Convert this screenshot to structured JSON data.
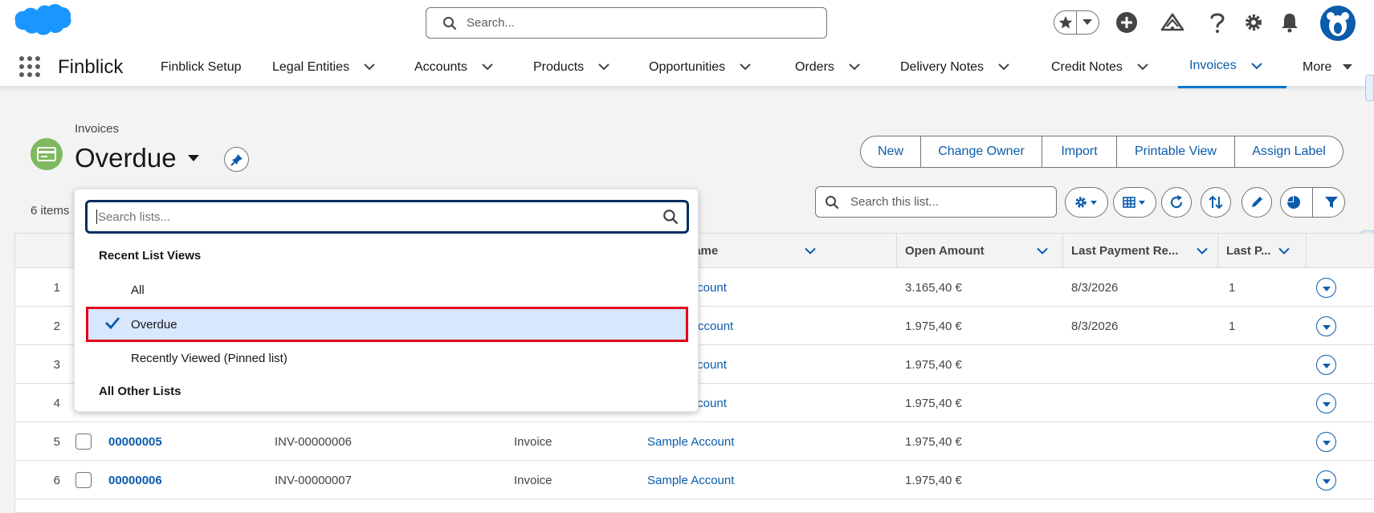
{
  "header": {
    "search_placeholder": "Search...",
    "icons": [
      "favorites-star-icon",
      "favorites-list-icon",
      "global-actions-icon",
      "trailhead-icon",
      "help-icon",
      "setup-gear-icon",
      "notifications-bell-icon",
      "user-avatar"
    ]
  },
  "nav": {
    "app_name": "Finblick",
    "items": [
      {
        "label": "Finblick Setup",
        "has_menu": false
      },
      {
        "label": "Legal Entities",
        "has_menu": true
      },
      {
        "label": "Accounts",
        "has_menu": true
      },
      {
        "label": "Products",
        "has_menu": true
      },
      {
        "label": "Opportunities",
        "has_menu": true
      },
      {
        "label": "Orders",
        "has_menu": true
      },
      {
        "label": "Delivery Notes",
        "has_menu": true
      },
      {
        "label": "Credit Notes",
        "has_menu": true
      },
      {
        "label": "Invoices",
        "has_menu": true,
        "active": true
      },
      {
        "label": "More",
        "has_menu": true
      }
    ]
  },
  "page": {
    "breadcrumb": "Invoices",
    "title": "Overdue",
    "items_count": "6 items",
    "actions": [
      "New",
      "Change Owner",
      "Import",
      "Printable View",
      "Assign Label"
    ],
    "list_search_placeholder": "Search this list..."
  },
  "table": {
    "columns": [
      {
        "label": "",
        "key": "num"
      },
      {
        "label": "",
        "key": "select"
      },
      {
        "label": "",
        "key": "number"
      },
      {
        "label": "",
        "key": "invoice_no"
      },
      {
        "label": "",
        "key": "type"
      },
      {
        "label": "nt Name",
        "key": "account"
      },
      {
        "label": "Open Amount",
        "key": "open_amount"
      },
      {
        "label": "Last Payment Re...",
        "key": "last_payment"
      },
      {
        "label": "Last P...",
        "key": "last_p"
      }
    ],
    "rows": [
      {
        "num": "1",
        "number": "",
        "invoice_no": "",
        "type": "",
        "account": "e Account",
        "open_amount": "3.165,40 €",
        "last_payment": "8/3/2026",
        "last_p": "1"
      },
      {
        "num": "2",
        "number": "",
        "invoice_no": "",
        "type": "",
        "account": "Account",
        "open_amount": "1.975,40 €",
        "last_payment": "8/3/2026",
        "last_p": "1"
      },
      {
        "num": "3",
        "number": "",
        "invoice_no": "",
        "type": "",
        "account": "e Account",
        "open_amount": "1.975,40 €",
        "last_payment": "",
        "last_p": ""
      },
      {
        "num": "4",
        "number": "",
        "invoice_no": "",
        "type": "",
        "account": "e Account",
        "open_amount": "1.975,40 €",
        "last_payment": "",
        "last_p": ""
      },
      {
        "num": "5",
        "number": "00000005",
        "invoice_no": "INV-00000006",
        "type": "Invoice",
        "account": "Sample Account",
        "open_amount": "1.975,40 €",
        "last_payment": "",
        "last_p": ""
      },
      {
        "num": "6",
        "number": "00000006",
        "invoice_no": "INV-00000007",
        "type": "Invoice",
        "account": "Sample Account",
        "open_amount": "1.975,40 €",
        "last_payment": "",
        "last_p": ""
      }
    ]
  },
  "dropdown": {
    "search_placeholder": "Search lists...",
    "section_recent": "Recent List Views",
    "items": [
      {
        "label": "All",
        "selected": false
      },
      {
        "label": "Overdue",
        "selected": true
      },
      {
        "label": "Recently Viewed (Pinned list)",
        "selected": false
      }
    ],
    "section_other": "All Other Lists"
  },
  "colors": {
    "accent": "#0b5cab",
    "brand_cloud": "#1b96ff",
    "object_icon": "#7fb95f",
    "selected_bg": "#d8e6fe",
    "highlight_border": "#e3001b"
  }
}
